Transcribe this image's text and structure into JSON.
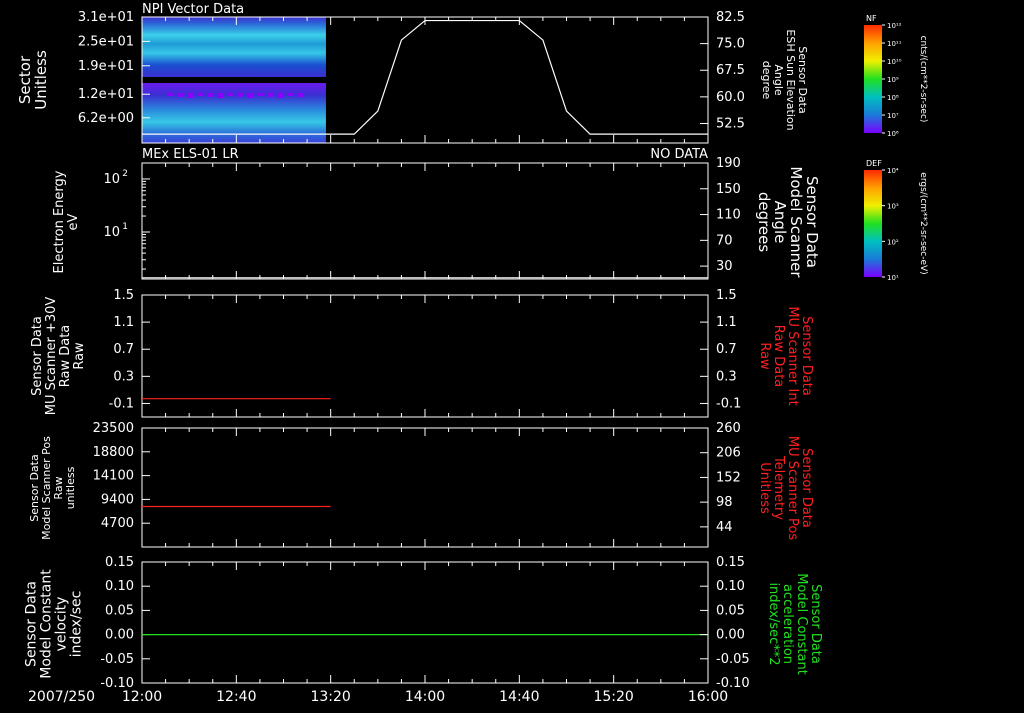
{
  "page": {
    "date": "2007/250",
    "time_ticks": [
      "12:00",
      "12:40",
      "13:20",
      "14:00",
      "14:40",
      "15:20",
      "16:00"
    ]
  },
  "colorbars": [
    {
      "id": "nf",
      "title": "NF",
      "unit": "cnts/(cm**2-sr-sec)",
      "ticks": [
        "10¹²",
        "10¹¹",
        "10¹⁰",
        "10⁹",
        "10⁸",
        "10⁷",
        "10⁶"
      ],
      "colors": [
        "#ff2a00",
        "#ffa000",
        "#f0f000",
        "#20e020",
        "#00c0c0",
        "#1a7ad8",
        "#7a00ff"
      ]
    },
    {
      "id": "def",
      "title": "DEF",
      "unit": "ergs/(cm**2-sr-sec-eV)",
      "ticks": [
        "10⁴",
        "10³",
        "10²",
        "10¹"
      ],
      "colors": [
        "#ff2a00",
        "#ffa000",
        "#f0f000",
        "#20e020",
        "#00c0c0",
        "#1a7ad8",
        "#7a00ff"
      ]
    }
  ],
  "chart_data": [
    {
      "type": "heatmap",
      "title": "NPI Vector Data",
      "ylabel": [
        "Sector",
        "Unitless"
      ],
      "ylim": [
        0,
        31
      ],
      "yticks": [
        {
          "v": 31.0,
          "label": "3.1e+01"
        },
        {
          "v": 25.0,
          "label": "2.5e+01"
        },
        {
          "v": 19.0,
          "label": "1.9e+01"
        },
        {
          "v": 12.0,
          "label": "1.2e+01"
        },
        {
          "v": 6.2,
          "label": "6.2e+00"
        }
      ],
      "heatmap_extent_time": [
        "12:00",
        "13:18"
      ],
      "right_series": {
        "type": "line",
        "ylabel": [
          "Sensor Data",
          "ESH Sun Elevation",
          "Angle",
          "degree"
        ],
        "ylim": [
          47,
          82.5
        ],
        "yticks": [
          "82.5",
          "75.0",
          "67.5",
          "60.0",
          "52.5"
        ],
        "ytick_values": [
          82.5,
          75.0,
          67.5,
          60.0,
          52.5
        ],
        "x": [
          "12:00",
          "13:30",
          "13:40",
          "13:50",
          "14:00",
          "14:40",
          "14:50",
          "15:00",
          "15:10",
          "16:00"
        ],
        "y": [
          49.5,
          49.5,
          56,
          76,
          81.5,
          81.5,
          76,
          56,
          49.5,
          49.5
        ],
        "color": "#ffffff"
      }
    },
    {
      "type": "line",
      "title": "MEx ELS-01 LR",
      "status": "NO DATA",
      "ylabel": [
        "Electron Energy",
        "eV"
      ],
      "log_y": true,
      "yticks": [
        {
          "base": "10",
          "exp": "2",
          "v": 100
        },
        {
          "base": "10",
          "exp": "1",
          "v": 10
        }
      ],
      "right_series": {
        "ylabel": [
          "Sensor Data",
          "Model Scanner",
          "Angle",
          "degrees"
        ],
        "ylim": [
          10,
          190
        ],
        "yticks": [
          "190",
          "150",
          "110",
          "70",
          "30"
        ],
        "ytick_values": [
          190,
          150,
          110,
          70,
          30
        ],
        "x": [
          "12:00",
          "16:00"
        ],
        "y": [
          12,
          12
        ],
        "color": "#ffffff"
      }
    },
    {
      "type": "line",
      "ylabel": [
        "Sensor Data",
        "MU Scanner +30V",
        "Raw Data",
        "Raw"
      ],
      "ylim": [
        -0.3,
        1.5
      ],
      "yticks": [
        "1.5",
        "1.1",
        "0.7",
        "0.3",
        "-0.1"
      ],
      "ytick_values": [
        1.5,
        1.1,
        0.7,
        0.3,
        -0.1
      ],
      "series": [
        {
          "x": [
            "12:00",
            "13:20"
          ],
          "y": [
            -0.03,
            -0.03
          ],
          "color": "#ff2020"
        }
      ],
      "right_axis": {
        "ylabel": [
          "Sensor Data",
          "MU Scanner Int",
          "Raw Data",
          "Raw"
        ],
        "ylabel_color": "#ff2020",
        "yticks": [
          "1.5",
          "1.1",
          "0.7",
          "0.3",
          "-0.1"
        ]
      }
    },
    {
      "type": "line",
      "ylabel": [
        "Sensor Data",
        "Model Scanner Pos",
        "Raw",
        "unitless"
      ],
      "ylim": [
        0,
        23500
      ],
      "yticks": [
        "23500",
        "18800",
        "14100",
        "9400",
        "4700"
      ],
      "ytick_values": [
        23500,
        18800,
        14100,
        9400,
        4700
      ],
      "series": [
        {
          "x": [
            "12:00",
            "13:20"
          ],
          "y": [
            8000,
            8000
          ],
          "color": "#ff2020"
        }
      ],
      "right_axis": {
        "ylabel": [
          "Sensor Data",
          "MU Scanner Pos",
          "Telemetry",
          "Unitless"
        ],
        "ylabel_color": "#ff2020",
        "ylim": [
          0,
          260
        ],
        "yticks": [
          "260",
          "206",
          "152",
          "98",
          "44"
        ],
        "ytick_values": [
          260,
          206,
          152,
          98,
          44
        ]
      }
    },
    {
      "type": "line",
      "ylabel": [
        "Sensor Data",
        "Model Constant",
        "velocity",
        "index/sec"
      ],
      "ylim": [
        -0.1,
        0.15
      ],
      "yticks": [
        "0.15",
        "0.10",
        "0.05",
        "0.00",
        "-0.05",
        "-0.10"
      ],
      "ytick_values": [
        0.15,
        0.1,
        0.05,
        0.0,
        -0.05,
        -0.1
      ],
      "series": [
        {
          "x": [
            "12:00",
            "16:00"
          ],
          "y": [
            0.0,
            0.0
          ],
          "color": "#20e020"
        }
      ],
      "right_axis": {
        "ylabel": [
          "Sensor Data",
          "Model Constant",
          "acceleration",
          "index/sec**2"
        ],
        "ylabel_color": "#20e020",
        "yticks": [
          "0.15",
          "0.10",
          "0.05",
          "0.00",
          "-0.05",
          "-0.10"
        ]
      }
    }
  ]
}
